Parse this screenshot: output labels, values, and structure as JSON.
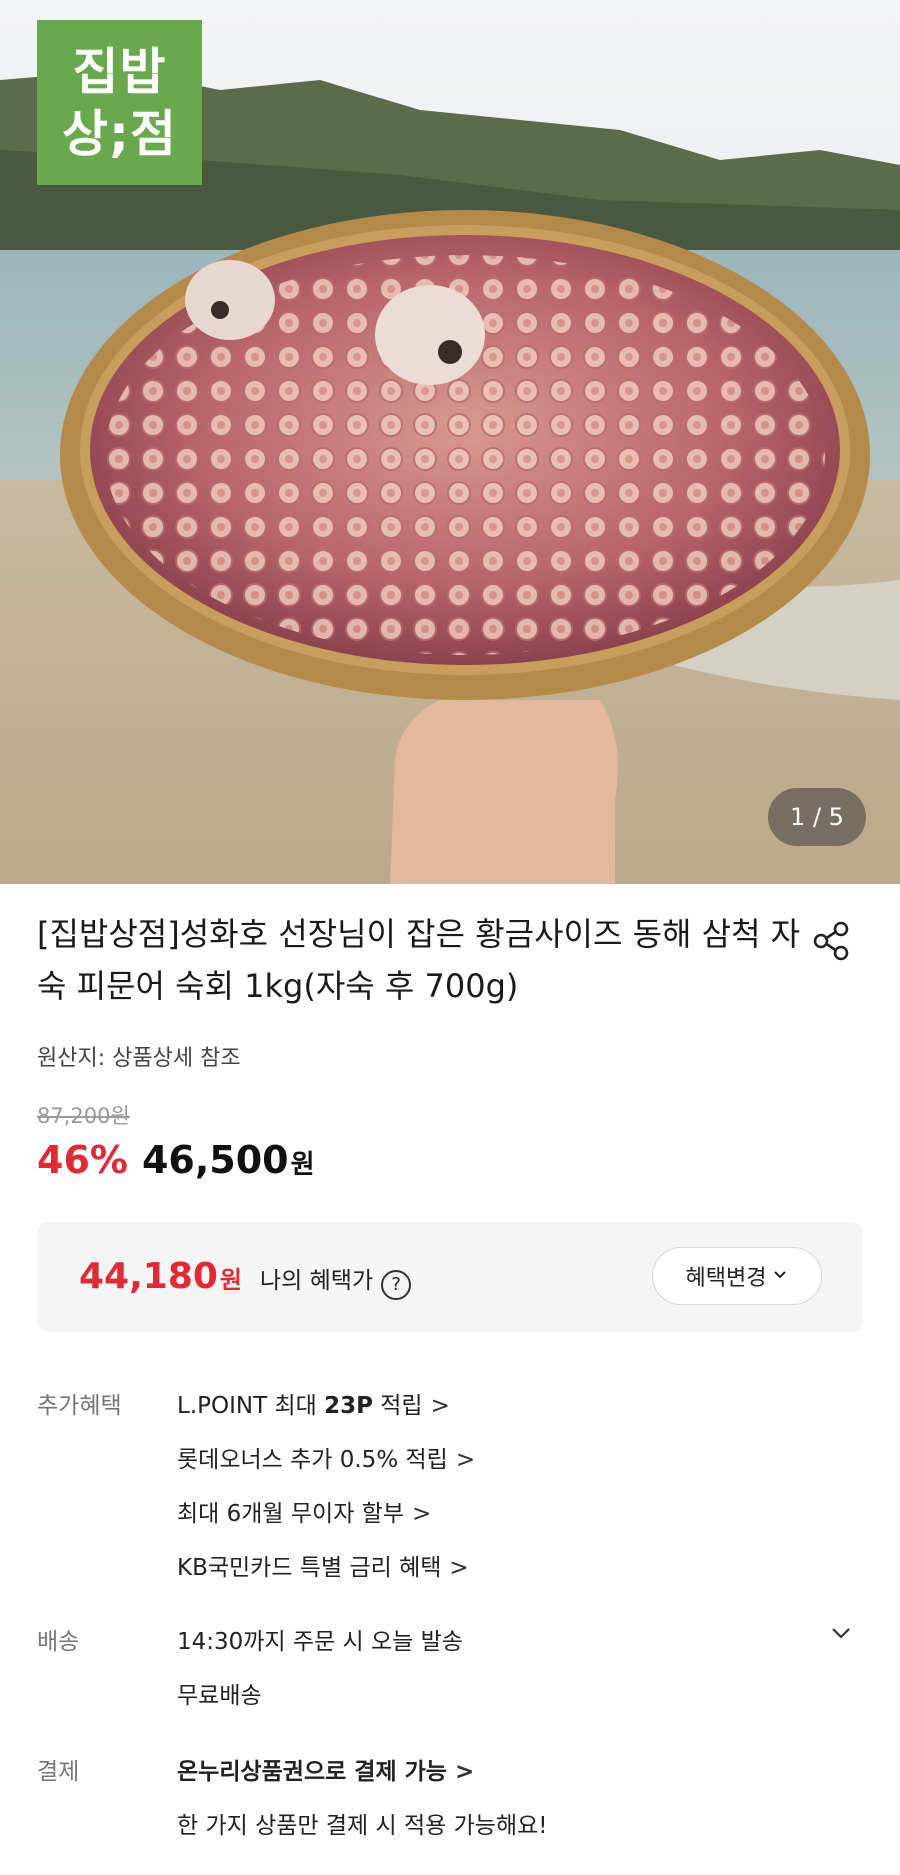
{
  "hero": {
    "logo_line1": "집밥",
    "logo_line2": "상;점",
    "image_counter": "1 / 5"
  },
  "product": {
    "title": "[집밥상점]성화호 선장님이 잡은 황금사이즈 동해 삼척 자숙 피문어 숙회 1kg(자숙 후 700g)",
    "origin": "원산지: 상품상세 참조",
    "original_price": "87,200원",
    "discount_rate": "46%",
    "sale_price": "46,500",
    "price_unit": "원"
  },
  "benefit": {
    "price": "44,180",
    "price_unit": "원",
    "label": "나의 혜택가",
    "help": "?",
    "change_button": "혜택변경"
  },
  "extra_benefits": {
    "label": "추가혜택",
    "items": [
      {
        "prefix": "L.POINT 최대 ",
        "bold": "23P",
        "suffix": " 적립"
      },
      {
        "prefix": "롯데오너스 추가 0.5% 적립",
        "bold": "",
        "suffix": ""
      },
      {
        "prefix": "최대 6개월 무이자 할부",
        "bold": "",
        "suffix": ""
      },
      {
        "prefix": "KB국민카드 특별 금리 혜택",
        "bold": "",
        "suffix": ""
      }
    ]
  },
  "delivery": {
    "label": "배송",
    "line1": "14:30까지 주문 시 오늘 발송",
    "line2": "무료배송"
  },
  "payment": {
    "label": "결제",
    "line1": "온누리상품권으로 결제 가능",
    "line2": "한 가지 상품만 결제 시 적용 가능해요!"
  },
  "colors": {
    "accent_red": "#e02a36",
    "logo_green": "#6aa84f"
  },
  "icons": {
    "share": "share-icon",
    "help": "question-circle-icon",
    "chevron_down": "chevron-down-icon",
    "chevron_right": "chevron-right-icon"
  }
}
